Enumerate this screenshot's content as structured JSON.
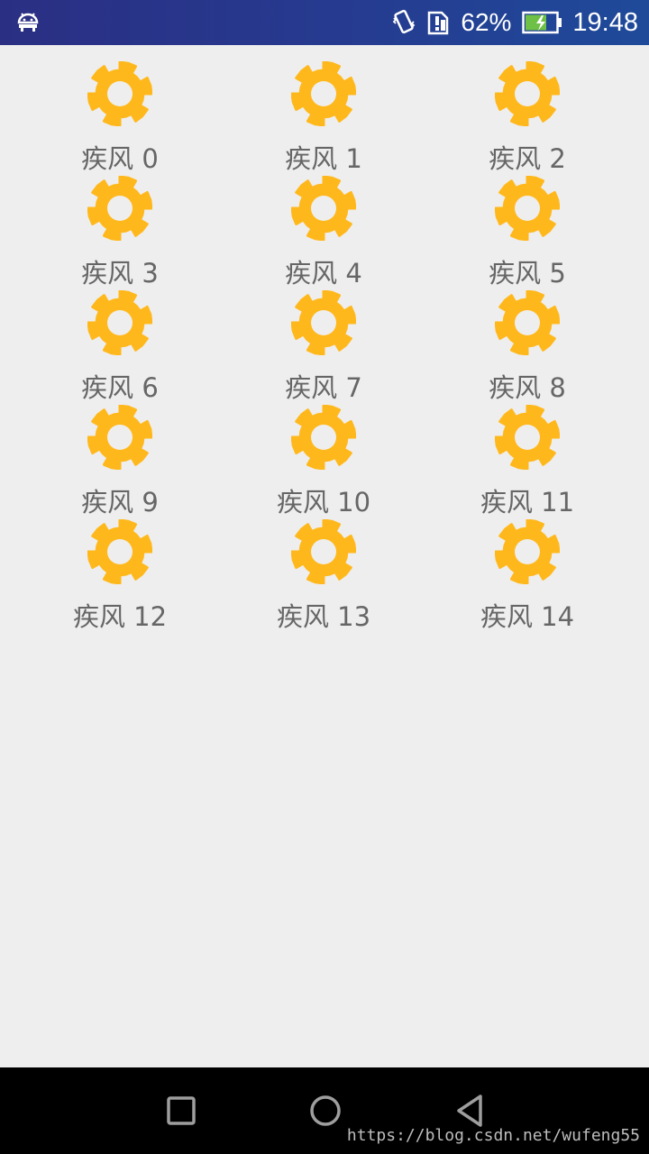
{
  "status_bar": {
    "battery_percent": "62%",
    "time": "19:48",
    "icons": [
      "android-debug-icon",
      "vibrate-icon",
      "sim-alert-icon",
      "battery-charging-icon"
    ]
  },
  "grid": {
    "icon": "gear-icon",
    "accent_color": "#FFB81C",
    "items": [
      {
        "label": "疾风 0"
      },
      {
        "label": "疾风 1"
      },
      {
        "label": "疾风 2"
      },
      {
        "label": "疾风 3"
      },
      {
        "label": "疾风 4"
      },
      {
        "label": "疾风 5"
      },
      {
        "label": "疾风 6"
      },
      {
        "label": "疾风 7"
      },
      {
        "label": "疾风 8"
      },
      {
        "label": "疾风 9"
      },
      {
        "label": "疾风 10"
      },
      {
        "label": "疾风 11"
      },
      {
        "label": "疾风 12"
      },
      {
        "label": "疾风 13"
      },
      {
        "label": "疾风 14"
      }
    ]
  },
  "nav_bar": {
    "buttons": [
      "recents-icon",
      "home-icon",
      "back-icon"
    ]
  },
  "watermark": "https://blog.csdn.net/wufeng55"
}
